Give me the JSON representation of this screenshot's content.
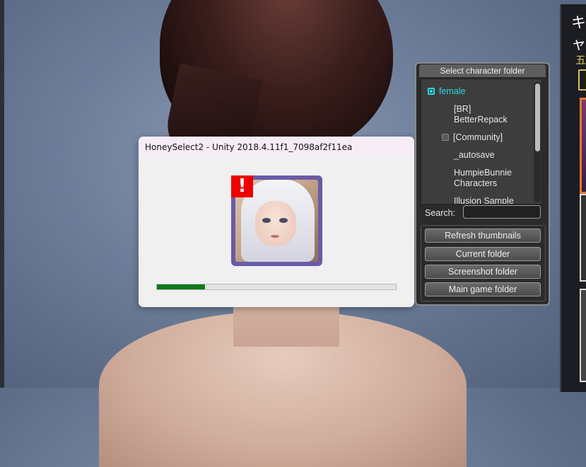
{
  "game": {
    "right_panel_title": "キャ",
    "right_panel_subtitle": "五"
  },
  "dialog": {
    "title": "HoneySelect2 - Unity 2018.4.11f1_7098af2f11ea",
    "warning_glyph": "!",
    "progress_percent": 20
  },
  "folder_panel": {
    "title": "Select character folder",
    "tree": [
      {
        "label": "female",
        "selected": true
      },
      {
        "label": "[BR]\nBetterRepack"
      },
      {
        "label": "[Community]"
      },
      {
        "label": "_autosave"
      },
      {
        "label": "HumpieBunnie\nCharacters"
      },
      {
        "label": "Illusion Sample"
      }
    ],
    "search_label": "Search:",
    "search_value": "",
    "buttons": {
      "refresh": "Refresh thumbnails",
      "current": "Current folder",
      "screenshot": "Screenshot folder",
      "main_game": "Main game folder"
    }
  },
  "colors": {
    "selected_item": "#2fd6e6",
    "progress_fill": "#0f7a1c",
    "warning_badge": "#ee0000",
    "icon_frame": "#6a5aa8"
  }
}
